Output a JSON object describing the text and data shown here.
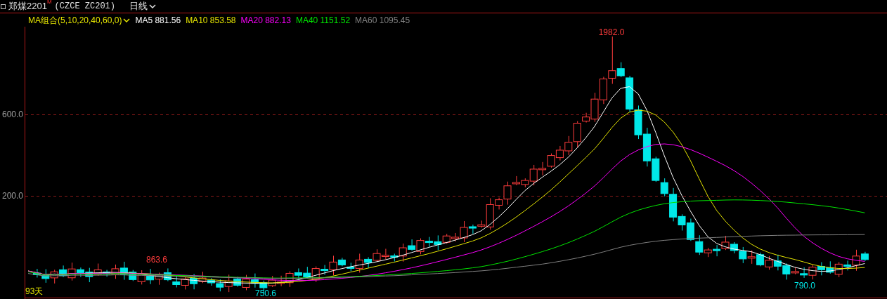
{
  "header": {
    "symbol": "郑煤2201",
    "marker": "M",
    "code": "(CZCE ZC201)",
    "period": "日线"
  },
  "legend": {
    "combo": "MA组合(5,10,20,40,60,0)",
    "items": [
      {
        "label": "MA5 881.56",
        "color": "#ffffff"
      },
      {
        "label": "MA10 853.58",
        "color": "#e6e600"
      },
      {
        "label": "MA20 882.13",
        "color": "#ff00ff"
      },
      {
        "label": "MA40 1151.52",
        "color": "#00e600"
      },
      {
        "label": "MA60 1095.45",
        "color": "#808080"
      }
    ]
  },
  "y_axis": {
    "ticks": [
      "600.0",
      "200.0"
    ]
  },
  "annotations": [
    {
      "kind": "high",
      "text": "1982.0"
    },
    {
      "kind": "high",
      "text": "863.6"
    },
    {
      "kind": "low",
      "text": "750.6"
    },
    {
      "kind": "low",
      "text": "790.0"
    },
    {
      "kind": "span",
      "text": "93天"
    }
  ]
}
